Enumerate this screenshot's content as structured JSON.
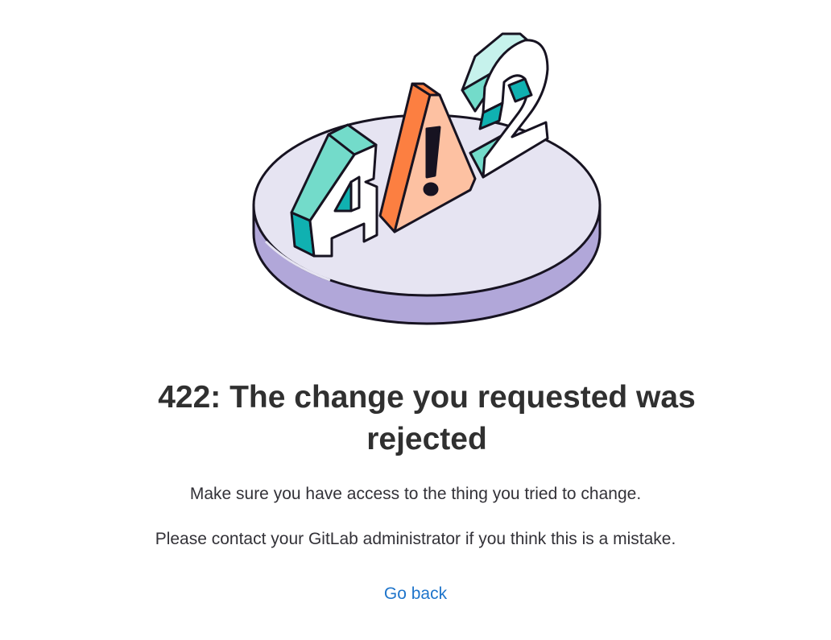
{
  "illustration": {
    "icon": "error-422-illustration",
    "glyphs": [
      "4",
      "!",
      "2"
    ],
    "colors": {
      "platform_top": "#e6e4f2",
      "platform_side": "#b1a7d9",
      "teal_light": "#73dbca",
      "teal_dark": "#10b1b1",
      "teal_pale": "#c6f2ec",
      "orange": "#fc7f41",
      "peach": "#fdc1a2",
      "outline": "#171321"
    }
  },
  "error": {
    "title": "422: The change you requested was rejected",
    "message_1": "Make sure you have access to the thing you tried to change.",
    "message_2": "Please contact your GitLab administrator if you think this is a mistake.",
    "back_link": "Go back"
  },
  "colors": {
    "text": "#303030",
    "link": "#1f75cb"
  }
}
